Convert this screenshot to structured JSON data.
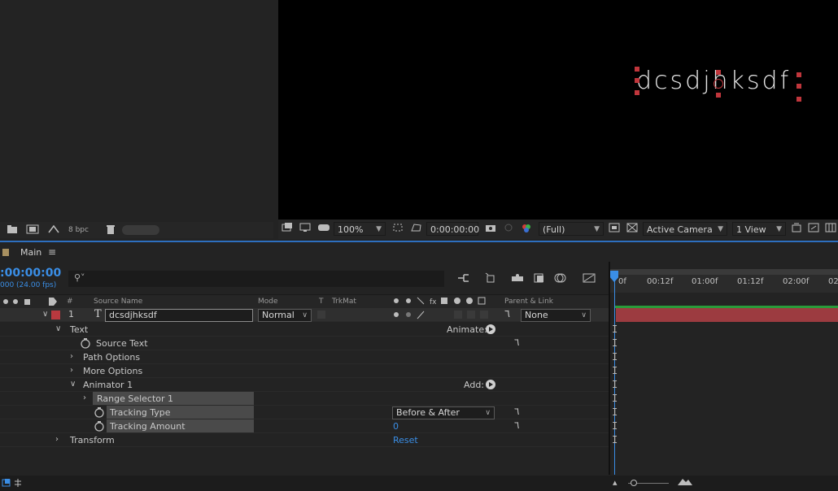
{
  "project": {
    "bpc_label": "8 bpc"
  },
  "viewer": {
    "overlay_text": "dcsdjhksdf",
    "zoom": "100%",
    "timecode": "0:00:00:00",
    "resolution": "(Full)",
    "camera": "Active Camera",
    "view": "1 View"
  },
  "comp": {
    "tab_name": "Main",
    "timecode": ":00:00:00",
    "fps": "000 (24.00 fps)"
  },
  "columns": {
    "num": "#",
    "source_name": "Source Name",
    "mode": "Mode",
    "t": "T",
    "trkmat": "TrkMat",
    "parent": "Parent & Link"
  },
  "layer": {
    "index": "1",
    "type_glyph": "T",
    "name": "dcsdjhksdf",
    "mode": "Normal",
    "parent": "None"
  },
  "props": {
    "text": "Text",
    "animate_label": "Animate:",
    "source_text": "Source Text",
    "path_options": "Path Options",
    "more_options": "More Options",
    "animator": "Animator 1",
    "add_label": "Add:",
    "range_selector": "Range Selector 1",
    "tracking_type": "Tracking Type",
    "tracking_type_value": "Before & After",
    "tracking_amount": "Tracking Amount",
    "tracking_amount_value": "0",
    "transform": "Transform",
    "transform_reset": "Reset"
  },
  "ruler": {
    "ticks": [
      "0f",
      "00:12f",
      "01:00f",
      "01:12f",
      "02:00f",
      "02"
    ]
  },
  "colors": {
    "accent": "#3a8ee6",
    "layer_label": "#b8393f",
    "layer_bar": "#9c3b40"
  }
}
